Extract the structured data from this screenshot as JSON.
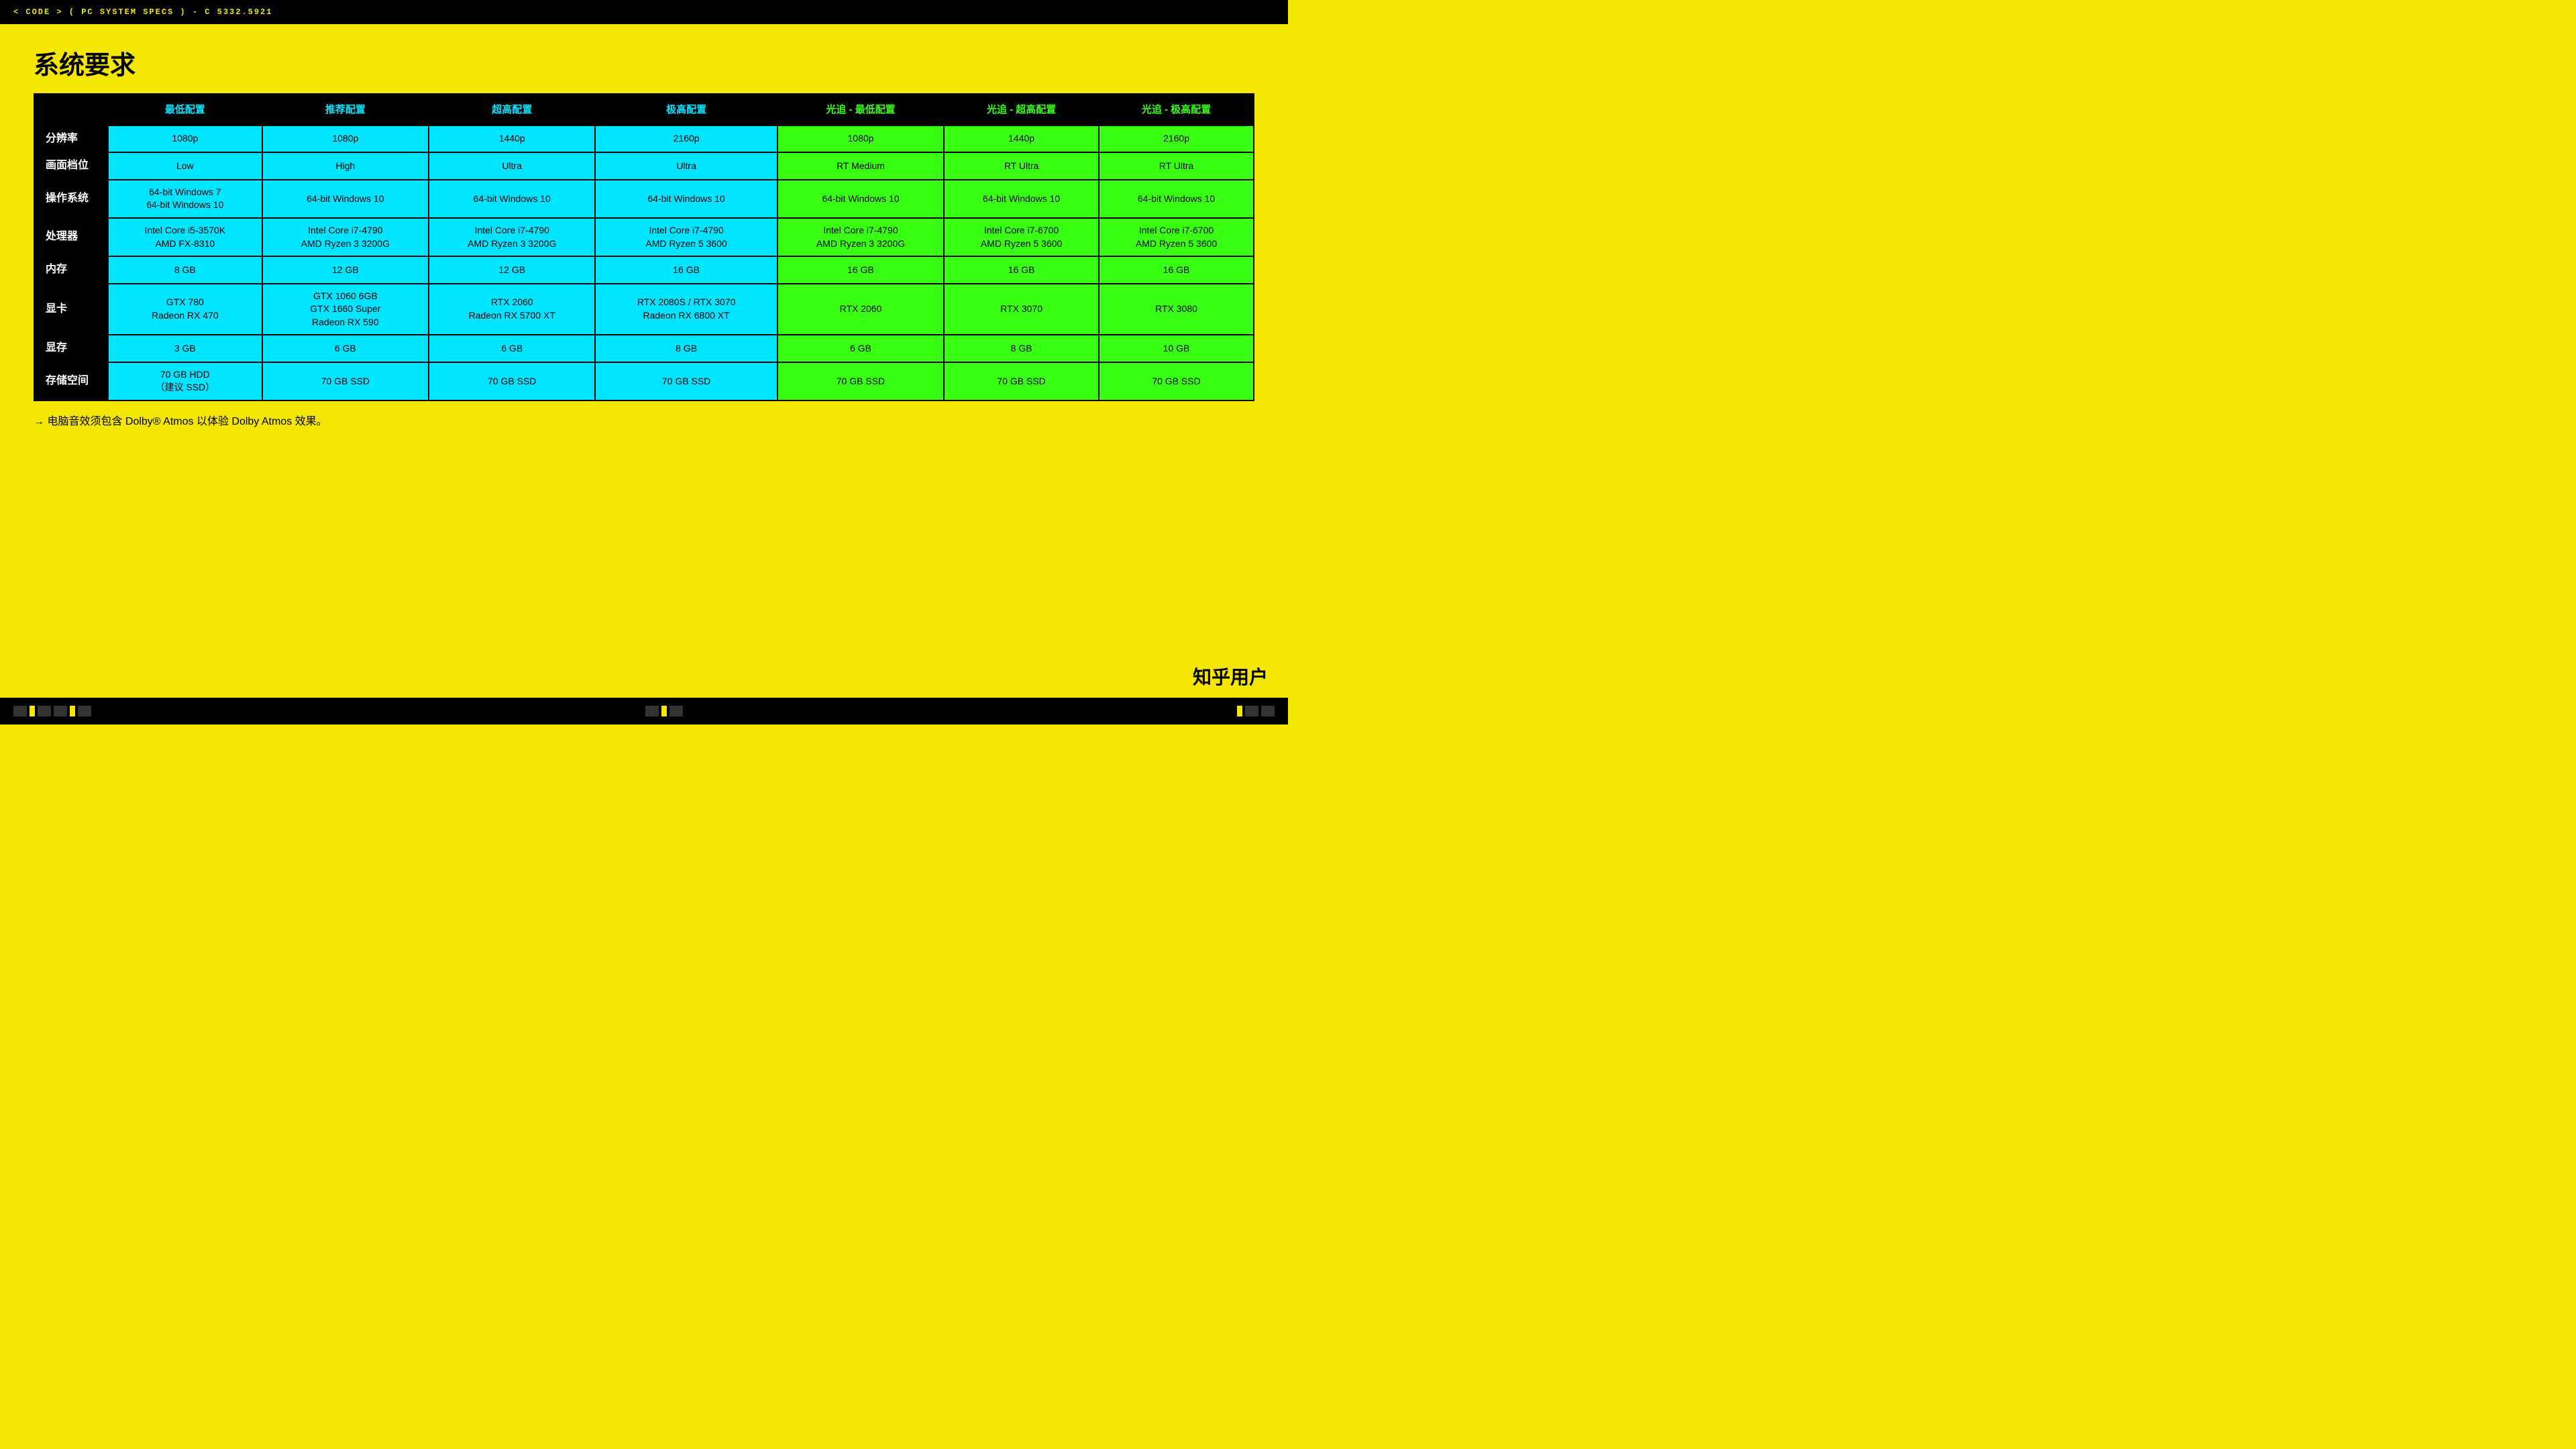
{
  "topbar": {
    "text": "< CODE > ( PC SYSTEM SPECS ) - C 5332.5921"
  },
  "page": {
    "title": "系统要求"
  },
  "table": {
    "headers": [
      {
        "label": "",
        "class": "row-label"
      },
      {
        "label": "最低配置",
        "class": ""
      },
      {
        "label": "推荐配置",
        "class": ""
      },
      {
        "label": "超高配置",
        "class": ""
      },
      {
        "label": "极高配置",
        "class": ""
      },
      {
        "label": "光追 - 最低配置",
        "class": "raytracing"
      },
      {
        "label": "光追 - 超高配置",
        "class": "raytracing"
      },
      {
        "label": "光追 - 极高配置",
        "class": "raytracing"
      }
    ],
    "rows": [
      {
        "label": "分辨率",
        "cells": [
          {
            "text": "1080p",
            "class": "cyan"
          },
          {
            "text": "1080p",
            "class": "cyan"
          },
          {
            "text": "1440p",
            "class": "cyan"
          },
          {
            "text": "2160p",
            "class": "cyan"
          },
          {
            "text": "1080p",
            "class": "green"
          },
          {
            "text": "1440p",
            "class": "green"
          },
          {
            "text": "2160p",
            "class": "green"
          }
        ]
      },
      {
        "label": "画面档位",
        "cells": [
          {
            "text": "Low",
            "class": "cyan"
          },
          {
            "text": "High",
            "class": "cyan"
          },
          {
            "text": "Ultra",
            "class": "cyan"
          },
          {
            "text": "Ultra",
            "class": "cyan"
          },
          {
            "text": "RT Medium",
            "class": "green"
          },
          {
            "text": "RT Ultra",
            "class": "green"
          },
          {
            "text": "RT Ultra",
            "class": "green"
          }
        ]
      },
      {
        "label": "操作系统",
        "cells": [
          {
            "text": "64-bit Windows 7\n64-bit Windows 10",
            "class": "cyan"
          },
          {
            "text": "64-bit Windows 10",
            "class": "cyan"
          },
          {
            "text": "64-bit Windows 10",
            "class": "cyan"
          },
          {
            "text": "64-bit Windows 10",
            "class": "cyan"
          },
          {
            "text": "64-bit Windows 10",
            "class": "green"
          },
          {
            "text": "64-bit Windows 10",
            "class": "green"
          },
          {
            "text": "64-bit Windows 10",
            "class": "green"
          }
        ]
      },
      {
        "label": "处理器",
        "cells": [
          {
            "text": "Intel Core i5-3570K\nAMD FX-8310",
            "class": "cyan"
          },
          {
            "text": "Intel Core i7-4790\nAMD Ryzen 3 3200G",
            "class": "cyan"
          },
          {
            "text": "Intel Core i7-4790\nAMD Ryzen 3 3200G",
            "class": "cyan"
          },
          {
            "text": "Intel Core i7-4790\nAMD Ryzen 5 3600",
            "class": "cyan"
          },
          {
            "text": "Intel Core i7-4790\nAMD Ryzen 3 3200G",
            "class": "green"
          },
          {
            "text": "Intel Core i7-6700\nAMD Ryzen 5 3600",
            "class": "green"
          },
          {
            "text": "Intel Core i7-6700\nAMD Ryzen 5 3600",
            "class": "green"
          }
        ]
      },
      {
        "label": "内存",
        "cells": [
          {
            "text": "8 GB",
            "class": "cyan"
          },
          {
            "text": "12 GB",
            "class": "cyan"
          },
          {
            "text": "12 GB",
            "class": "cyan"
          },
          {
            "text": "16 GB",
            "class": "cyan"
          },
          {
            "text": "16 GB",
            "class": "green"
          },
          {
            "text": "16 GB",
            "class": "green"
          },
          {
            "text": "16 GB",
            "class": "green"
          }
        ]
      },
      {
        "label": "显卡",
        "cells": [
          {
            "text": "GTX 780\nRadeon RX 470",
            "class": "cyan"
          },
          {
            "text": "GTX 1060 6GB\nGTX 1660 Super\nRadeon RX 590",
            "class": "cyan"
          },
          {
            "text": "RTX 2060\nRadeon RX 5700 XT",
            "class": "cyan"
          },
          {
            "text": "RTX 2080S / RTX 3070\nRadeon RX 6800 XT",
            "class": "cyan"
          },
          {
            "text": "RTX 2060",
            "class": "green"
          },
          {
            "text": "RTX 3070",
            "class": "green"
          },
          {
            "text": "RTX 3080",
            "class": "green"
          }
        ]
      },
      {
        "label": "显存",
        "cells": [
          {
            "text": "3 GB",
            "class": "cyan"
          },
          {
            "text": "6 GB",
            "class": "cyan"
          },
          {
            "text": "6 GB",
            "class": "cyan"
          },
          {
            "text": "8 GB",
            "class": "cyan"
          },
          {
            "text": "6 GB",
            "class": "green"
          },
          {
            "text": "8 GB",
            "class": "green"
          },
          {
            "text": "10 GB",
            "class": "green"
          }
        ]
      },
      {
        "label": "存储空间",
        "cells": [
          {
            "text": "70 GB HDD\n（建议 SSD）",
            "class": "cyan"
          },
          {
            "text": "70 GB SSD",
            "class": "cyan"
          },
          {
            "text": "70 GB SSD",
            "class": "cyan"
          },
          {
            "text": "70 GB SSD",
            "class": "cyan"
          },
          {
            "text": "70 GB SSD",
            "class": "green"
          },
          {
            "text": "70 GB SSD",
            "class": "green"
          },
          {
            "text": "70 GB SSD",
            "class": "green"
          }
        ]
      }
    ]
  },
  "footer": {
    "note": "→ 电脑音效须包含 Dolby® Atmos 以体验 Dolby Atmos 效果。"
  },
  "watermark": {
    "text": "知乎用户"
  }
}
